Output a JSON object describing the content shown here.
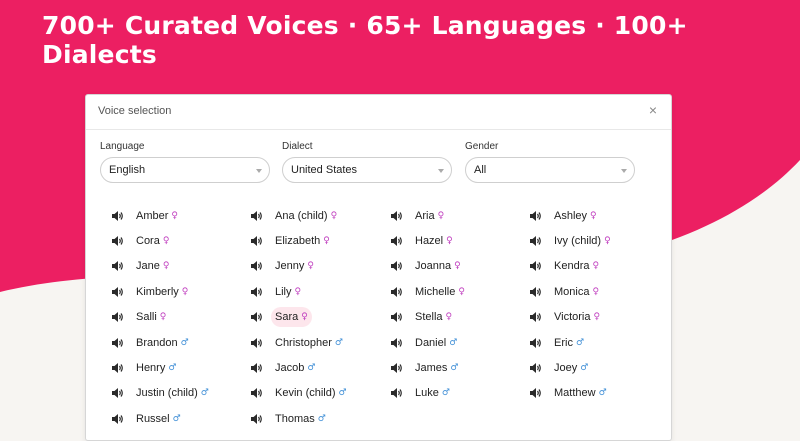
{
  "hero": {
    "headline": "700+ Curated Voices · 65+ Languages · 100+ Dialects",
    "bg_color": "#ec1f62"
  },
  "modal": {
    "title": "Voice selection",
    "close_glyph": "×"
  },
  "filters": [
    {
      "label": "Language",
      "value": "English",
      "name": "language"
    },
    {
      "label": "Dialect",
      "value": "United States",
      "name": "dialect"
    },
    {
      "label": "Gender",
      "value": "All",
      "name": "gender"
    }
  ],
  "gender_symbols": {
    "f": "♀",
    "m": "♂"
  },
  "colors": {
    "female": "#c03fbf",
    "male": "#3e8ed6",
    "selected_bg": "#fde6ec"
  },
  "voices": [
    {
      "name": "Amber",
      "g": "f"
    },
    {
      "name": "Ana (child)",
      "g": "f"
    },
    {
      "name": "Aria",
      "g": "f"
    },
    {
      "name": "Ashley",
      "g": "f"
    },
    {
      "name": "Cora",
      "g": "f"
    },
    {
      "name": "Elizabeth",
      "g": "f"
    },
    {
      "name": "Hazel",
      "g": "f"
    },
    {
      "name": "Ivy (child)",
      "g": "f"
    },
    {
      "name": "Jane",
      "g": "f"
    },
    {
      "name": "Jenny",
      "g": "f"
    },
    {
      "name": "Joanna",
      "g": "f"
    },
    {
      "name": "Kendra",
      "g": "f"
    },
    {
      "name": "Kimberly",
      "g": "f"
    },
    {
      "name": "Lily",
      "g": "f"
    },
    {
      "name": "Michelle",
      "g": "f"
    },
    {
      "name": "Monica",
      "g": "f"
    },
    {
      "name": "Salli",
      "g": "f"
    },
    {
      "name": "Sara",
      "g": "f",
      "selected": true
    },
    {
      "name": "Stella",
      "g": "f"
    },
    {
      "name": "Victoria",
      "g": "f"
    },
    {
      "name": "Brandon",
      "g": "m"
    },
    {
      "name": "Christopher",
      "g": "m"
    },
    {
      "name": "Daniel",
      "g": "m"
    },
    {
      "name": "Eric",
      "g": "m"
    },
    {
      "name": "Henry",
      "g": "m"
    },
    {
      "name": "Jacob",
      "g": "m"
    },
    {
      "name": "James",
      "g": "m"
    },
    {
      "name": "Joey",
      "g": "m"
    },
    {
      "name": "Justin (child)",
      "g": "m"
    },
    {
      "name": "Kevin (child)",
      "g": "m"
    },
    {
      "name": "Luke",
      "g": "m"
    },
    {
      "name": "Matthew",
      "g": "m"
    },
    {
      "name": "Russel",
      "g": "m"
    },
    {
      "name": "Thomas",
      "g": "m"
    }
  ]
}
